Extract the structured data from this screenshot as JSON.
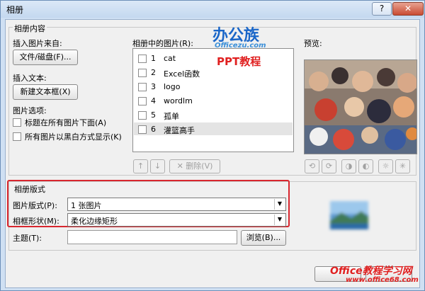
{
  "window": {
    "title": "相册",
    "help_label": "?",
    "close_label": "✕"
  },
  "album_content": {
    "legend": "相册内容",
    "insert_from_label": "插入图片来自:",
    "file_disk_button": "文件/磁盘(F)...",
    "insert_text_label": "插入文本:",
    "new_textbox_button": "新建文本框(X)",
    "picture_options_label": "图片选项:",
    "caption_below_label": "标题在所有图片下面(A)",
    "all_black_white_label": "所有图片以黑白方式显示(K)"
  },
  "picture_list": {
    "label": "相册中的图片(R):",
    "items": [
      {
        "num": "1",
        "name": "cat"
      },
      {
        "num": "2",
        "name": "Excel函数"
      },
      {
        "num": "3",
        "name": "logo"
      },
      {
        "num": "4",
        "name": "wordlm"
      },
      {
        "num": "5",
        "name": "孤单"
      },
      {
        "num": "6",
        "name": "灌篮高手"
      }
    ],
    "up_label": "↑",
    "down_label": "↓",
    "delete_label": "删除(V)"
  },
  "preview": {
    "label": "预览:"
  },
  "album_layout": {
    "legend": "相册版式",
    "picture_layout_label": "图片版式(P):",
    "picture_layout_value": "1 张图片",
    "frame_shape_label": "相框形状(M):",
    "frame_shape_value": "柔化边缘矩形",
    "theme_label": "主题(T):",
    "browse_button": "浏览(B)..."
  },
  "watermarks": {
    "brand_top": "办公族",
    "brand_url": "Officezu.com",
    "brand_sub": "PPT教程",
    "brand_bottom": "Office教程学习网",
    "brand_bottom_url": "www.office68.com"
  },
  "colors": {
    "highlight": "#d8262e",
    "brand_blue": "#1a66c8",
    "brand_red": "#e02020"
  }
}
